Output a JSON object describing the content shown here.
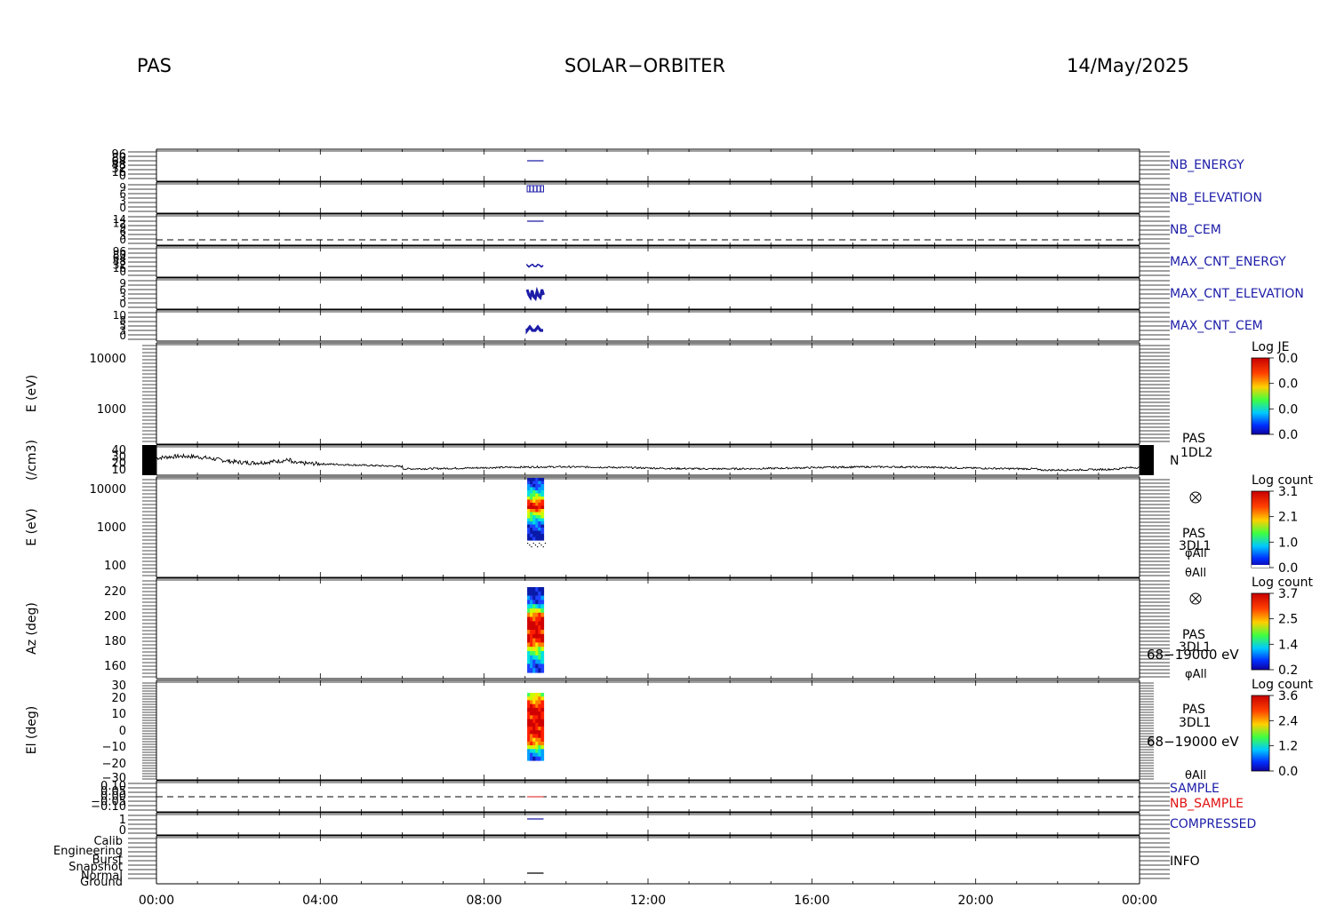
{
  "header": {
    "instrument": "PAS",
    "mission": "SOLAR−ORBITER",
    "date": "14/May/2025"
  },
  "chart_data": {
    "type": "multi-panel time series",
    "x_axis": {
      "ticks": [
        "00:00",
        "04:00",
        "08:00",
        "12:00",
        "16:00",
        "20:00",
        "00:00"
      ],
      "range_hours": [
        0,
        24
      ]
    },
    "colors": {
      "accent": "#1c1ca8",
      "red": "#e01010",
      "trace": "#000000"
    },
    "panels": [
      {
        "key": "nb_energy",
        "label": "NB_ENERGY",
        "label_color": "#1c1ca8",
        "tick_labels": [
          "96",
          "80",
          "64",
          "48",
          "32",
          "16",
          "0"
        ],
        "segment_hours": [
          9.05,
          9.45
        ]
      },
      {
        "key": "nb_elevation",
        "label": "NB_ELEVATION",
        "label_color": "#1c1ca8",
        "tick_labels": [
          "9",
          "6",
          "3",
          "0"
        ],
        "segment_hours": [
          9.05,
          9.45
        ]
      },
      {
        "key": "nb_cem",
        "label": "NB_CEM",
        "label_color": "#1c1ca8",
        "tick_labels": [
          "14",
          "12",
          "9",
          "6",
          "3",
          "0"
        ],
        "segment_hours": [
          9.05,
          9.45
        ]
      },
      {
        "key": "max_cnt_energy",
        "label": "MAX_CNT_ENERGY",
        "label_color": "#1c1ca8",
        "tick_labels": [
          "96",
          "80",
          "64",
          "48",
          "32",
          "16",
          "0"
        ],
        "segment_hours": [
          9.05,
          9.45
        ]
      },
      {
        "key": "max_cnt_elevation",
        "label": "MAX_CNT_ELEVATION",
        "label_color": "#1c1ca8",
        "tick_labels": [
          "9",
          "6",
          "3",
          "0"
        ],
        "segment_hours": [
          9.05,
          9.45
        ]
      },
      {
        "key": "max_cnt_cem",
        "label": "MAX_CNT_CEM",
        "label_color": "#1c1ca8",
        "tick_labels": [
          "10",
          "8",
          "5",
          "3",
          "0"
        ],
        "segment_hours": [
          9.05,
          9.45
        ]
      },
      {
        "key": "e_1dl2",
        "ylabel": "E (eV)",
        "tick_labels": [
          "10000",
          "1000"
        ],
        "colorbar": {
          "title": "Log JE",
          "ticks": [
            "0.0",
            "0.0",
            "0.0",
            "0.0"
          ]
        }
      },
      {
        "key": "density",
        "ylabel": "(/cm3)",
        "tick_labels": [
          "40",
          "30",
          "20",
          "10"
        ],
        "label_lines": [
          "PAS",
          "1DL2"
        ],
        "side_label": "N",
        "ylim": [
          5,
          42
        ]
      },
      {
        "key": "e_3dl1",
        "ylabel": "E (eV)",
        "tick_labels": [
          "10000",
          "1000",
          "100"
        ],
        "label_lines": [
          "PAS",
          "3DL1",
          "φAll",
          "θAll"
        ],
        "colorbar": {
          "title": "Log count",
          "ticks": [
            "3.1",
            "2.1",
            "1.0",
            "0.0"
          ]
        },
        "block_hours": [
          9.05,
          9.45
        ]
      },
      {
        "key": "az_3dl1",
        "ylabel": "Az (deg)",
        "tick_labels": [
          "220",
          "200",
          "180",
          "160"
        ],
        "label_lines": [
          "PAS",
          "3DL1",
          "68−19000 eV",
          "φAll"
        ],
        "colorbar": {
          "title": "Log count",
          "ticks": [
            "3.7",
            "2.5",
            "1.4",
            "0.2"
          ]
        },
        "block_hours": [
          9.05,
          9.45
        ]
      },
      {
        "key": "el_3dl1",
        "ylabel": "El (deg)",
        "tick_labels": [
          "30",
          "20",
          "10",
          "0",
          "−10",
          "−20",
          "−30"
        ],
        "label_lines": [
          "PAS",
          "3DL1",
          "68−19000 eV",
          "θAll"
        ],
        "colorbar": {
          "title": "Log count",
          "ticks": [
            "3.6",
            "2.4",
            "1.2",
            "0.0"
          ]
        },
        "block_hours": [
          9.05,
          9.45
        ]
      },
      {
        "key": "sample",
        "tick_labels": [
          "0.10",
          "0.05",
          "0.00",
          "−0.05",
          "−0.10"
        ],
        "labels": [
          {
            "text": "SAMPLE",
            "color": "#1c1ca8"
          },
          {
            "text": "NB_SAMPLE",
            "color": "#e01010"
          }
        ]
      },
      {
        "key": "compressed",
        "label": "COMPRESSED",
        "label_color": "#1c1ca8",
        "tick_labels": [
          "1",
          "0"
        ],
        "segment_hours": [
          9.05,
          9.45
        ]
      },
      {
        "key": "info",
        "label": "INFO",
        "label_color": "#000000",
        "tick_labels": [
          "Calib",
          "Engineering",
          "Burst",
          "Snapshot",
          "Normal",
          "Ground"
        ],
        "segment_hours": [
          9.05,
          9.45
        ]
      }
    ]
  }
}
